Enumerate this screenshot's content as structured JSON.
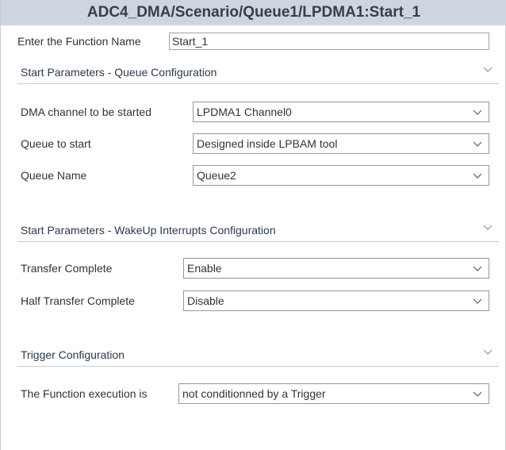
{
  "title": "ADC4_DMA/Scenario/Queue1/LPDMA1:Start_1",
  "function_name": {
    "label": "Enter the Function Name",
    "value": "Start_1"
  },
  "sections": {
    "queue_config": {
      "title": "Start Parameters - Queue Configuration",
      "fields": {
        "dma_channel": {
          "label": "DMA channel to be started",
          "value": "LPDMA1 Channel0"
        },
        "queue_to_start": {
          "label": "Queue to start",
          "value": "Designed inside LPBAM tool"
        },
        "queue_name": {
          "label": "Queue Name",
          "value": "Queue2"
        }
      }
    },
    "wakeup_config": {
      "title": "Start Parameters - WakeUp Interrupts Configuration",
      "fields": {
        "transfer_complete": {
          "label": "Transfer Complete",
          "value": "Enable"
        },
        "half_transfer_complete": {
          "label": "Half Transfer Complete",
          "value": "Disable"
        }
      }
    },
    "trigger_config": {
      "title": "Trigger Configuration",
      "fields": {
        "execution": {
          "label": "The Function execution is",
          "value": "not conditionned by a Trigger"
        }
      }
    }
  },
  "icons": {
    "section_toggle": "chevron-down-icon",
    "dropdown": "chevron-down-icon"
  },
  "colors": {
    "title_bar": "#cdd5df",
    "section_title": "#2b3a4c",
    "border": "#8f98a3"
  }
}
